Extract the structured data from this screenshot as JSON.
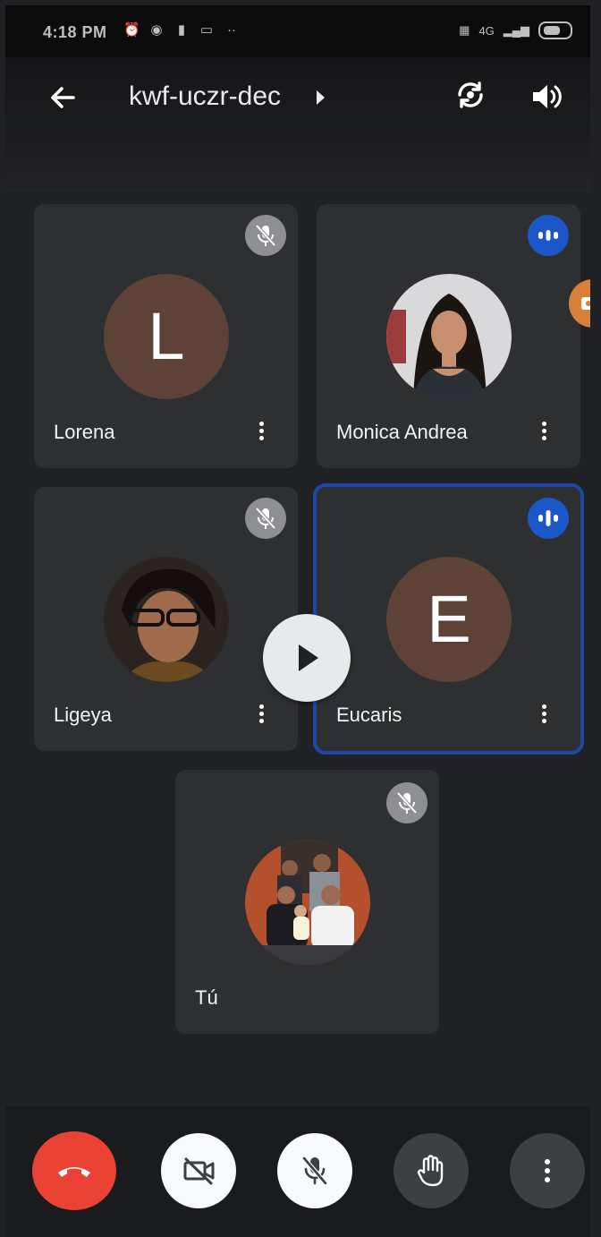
{
  "status_bar": {
    "time": "4:18 PM",
    "network": "4G"
  },
  "header": {
    "meeting_code": "kwf-uczr-dec"
  },
  "participants": [
    {
      "name": "Lorena",
      "initial": "L",
      "audio": "muted"
    },
    {
      "name": "Monica Andrea",
      "audio": "speaking"
    },
    {
      "name": "Ligeya",
      "audio": "muted"
    },
    {
      "name": "Eucaris",
      "initial": "E",
      "audio": "speaking",
      "active": true
    },
    {
      "name": "Tú",
      "audio": "muted"
    }
  ],
  "colors": {
    "background": "#202124",
    "tile": "#2d2f31",
    "avatar": "#5e4137",
    "speaking": "#1b57c6",
    "active_border": "#1a47a8",
    "end_call": "#ea4335"
  },
  "controls": [
    "end-call",
    "camera-off",
    "mic-off",
    "raise-hand",
    "more-options"
  ]
}
